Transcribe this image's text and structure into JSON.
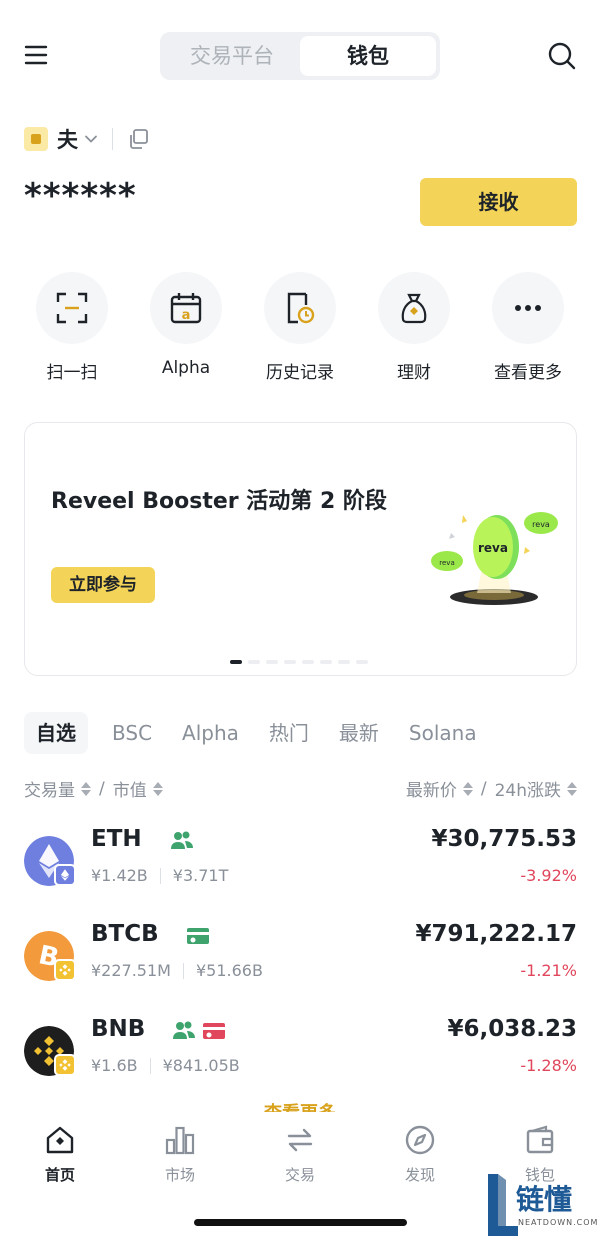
{
  "header": {
    "tabs": [
      "交易平台",
      "钱包"
    ],
    "active_tab": "钱包"
  },
  "account": {
    "name": "夫",
    "balance_masked": "******",
    "receive_label": "接收"
  },
  "quick_actions": [
    {
      "label": "扫一扫",
      "icon": "scan-icon"
    },
    {
      "label": "Alpha",
      "icon": "alpha-calendar-icon"
    },
    {
      "label": "历史记录",
      "icon": "history-icon"
    },
    {
      "label": "理财",
      "icon": "earn-bag-icon"
    },
    {
      "label": "查看更多",
      "icon": "more-dots-icon"
    }
  ],
  "banner": {
    "title": "Reveel Booster 活动第 2 阶段",
    "button": "立即参与",
    "art_text": "reva",
    "slide_count": 8,
    "active_slide": 0
  },
  "market_tabs": [
    "自选",
    "BSC",
    "Alpha",
    "热门",
    "最新",
    "Solana"
  ],
  "sort": {
    "left_a": "交易量",
    "left_b": "市值",
    "right_a": "最新价",
    "right_b": "24h涨跌",
    "slash": "/"
  },
  "tokens": [
    {
      "symbol": "ETH",
      "volume": "¥1.42B",
      "market_cap": "¥3.71T",
      "price": "¥30,775.53",
      "change": "-3.92%",
      "tags": [
        "people-icon"
      ],
      "logo_color": "#6f7fe0",
      "badge_color": "#6f7fe0"
    },
    {
      "symbol": "BTCB",
      "volume": "¥227.51M",
      "market_cap": "¥51.66B",
      "price": "¥791,222.17",
      "change": "-1.21%",
      "tags": [
        "card-icon-green"
      ],
      "logo_color": "#f29a3c",
      "badge_color": "#f3c233"
    },
    {
      "symbol": "BNB",
      "volume": "¥1.6B",
      "market_cap": "¥841.05B",
      "price": "¥6,038.23",
      "change": "-1.28%",
      "tags": [
        "people-icon",
        "card-icon-red"
      ],
      "logo_color": "#1e1e1e",
      "badge_color": "#f3c233"
    }
  ],
  "more_link": "查看更多",
  "bottom_nav": [
    {
      "label": "首页",
      "icon": "home-icon",
      "active": true
    },
    {
      "label": "市场",
      "icon": "market-bars-icon",
      "active": false
    },
    {
      "label": "交易",
      "icon": "swap-icon",
      "active": false
    },
    {
      "label": "发现",
      "icon": "compass-icon",
      "active": false
    },
    {
      "label": "钱包",
      "icon": "wallet-icon",
      "active": false
    }
  ],
  "watermark": {
    "text": "链懂",
    "sub": "NEATDOWN.COM"
  }
}
